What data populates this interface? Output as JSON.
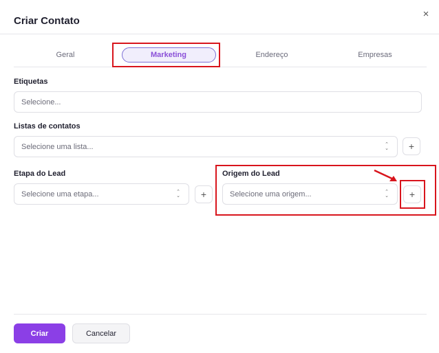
{
  "dialog": {
    "title": "Criar Contato",
    "close_icon": "×"
  },
  "tabs": [
    {
      "label": "Geral",
      "active": false
    },
    {
      "label": "Marketing",
      "active": true
    },
    {
      "label": "Endereço",
      "active": false
    },
    {
      "label": "Empresas",
      "active": false
    }
  ],
  "form": {
    "etiquetas": {
      "label": "Etiquetas",
      "placeholder": "Selecione..."
    },
    "listas": {
      "label": "Listas de contatos",
      "placeholder": "Selecione uma lista..."
    },
    "etapa": {
      "label": "Etapa do Lead",
      "placeholder": "Selecione uma etapa..."
    },
    "origem": {
      "label": "Origem do Lead",
      "placeholder": "Selecione uma origem..."
    },
    "plus_symbol": "+",
    "chevron_up": "⌃",
    "chevron_down": "⌄"
  },
  "footer": {
    "create_label": "Criar",
    "cancel_label": "Cancelar"
  },
  "colors": {
    "primary": "#8b3fe6",
    "tab_active_text": "#8a4fd8",
    "annotation_red": "#d8141c"
  },
  "icons": [
    "close-icon",
    "chevron-updown-icon",
    "plus-icon",
    "annotation-arrow"
  ]
}
